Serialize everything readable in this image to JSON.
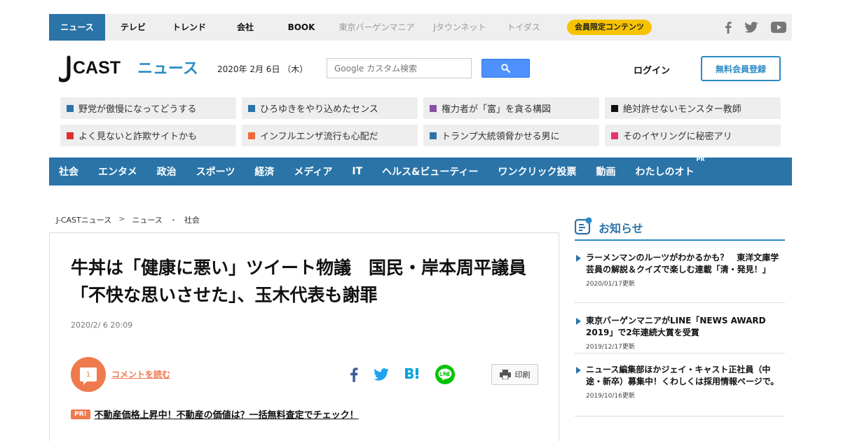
{
  "topnav": {
    "items": [
      {
        "label": "ニュース",
        "active": true
      },
      {
        "label": "テレビ"
      },
      {
        "label": "トレンド"
      },
      {
        "label": "会社"
      },
      {
        "label": "BOOK"
      },
      {
        "label": "東京バーゲンマニア",
        "muted": true
      },
      {
        "label": "Jタウンネット",
        "muted": true
      },
      {
        "label": "トイダス",
        "muted": true
      }
    ],
    "member_pill": "会員限定コンテンツ"
  },
  "header": {
    "logo_prefix": "J",
    "logo_cast": "CAST",
    "logo_news": "ニュース",
    "date": "2020年 2月 6日 （木）",
    "search_placeholder": "Google カスタム検索",
    "login": "ログイン",
    "register": "無料会員登録"
  },
  "topics": [
    {
      "text": "野党が傲慢になってどうする",
      "color": "#2a74a8"
    },
    {
      "text": "ひろゆきをやり込めたセンス",
      "color": "#2a74a8"
    },
    {
      "text": "権力者が「富」を貪る構図",
      "color": "#8a4fa8"
    },
    {
      "text": "絶対許せないモンスター教師",
      "color": "#111111"
    },
    {
      "text": "よく見ないと詐欺サイトかも",
      "color": "#e0302a"
    },
    {
      "text": "インフルエンザ流行も心配だ",
      "color": "#ef6a3a"
    },
    {
      "text": "トランプ大統領脅かせる男に",
      "color": "#2a74a8"
    },
    {
      "text": "そのイヤリングに秘密アリ",
      "color": "#e8336b"
    }
  ],
  "catnav": {
    "items": [
      "社会",
      "エンタメ",
      "政治",
      "スポーツ",
      "経済",
      "メディア",
      "IT",
      "ヘルス&ビューティー",
      "ワンクリック投票",
      "動画",
      "わたしのオト"
    ],
    "pr_badge": "PR"
  },
  "breadcrumb": [
    "J-CASTニュース",
    ">",
    "ニュース",
    "・",
    "社会"
  ],
  "article": {
    "title": "牛丼は「健康に悪い」ツイート物議　国民・岸本周平議員「不快な思いさせた」、玉木代表も謝罪",
    "date": "2020/2/ 6 20:09",
    "comment_count": "1",
    "comment_link": "コメントを読む",
    "print_label": "印刷",
    "pr_badge": "PR!",
    "pr_text": "不動産価格上昇中！不動産の価値は？一括無料査定でチェック！"
  },
  "sidebar": {
    "title": "お知らせ",
    "items": [
      {
        "text": "ラーメンマンのルーツがわかるかも？　東洋文庫学芸員の解説＆クイズで楽しむ連載「清・発見！」",
        "updated": "2020/01/17更新"
      },
      {
        "text": "東京バーゲンマニアがLINE「NEWS AWARD 2019」で2年連続大賞を受賞",
        "updated": "2019/12/17更新"
      },
      {
        "text": "ニュース編集部ほかジェイ・キャスト正社員（中途・新卒）募集中！くわしくは採用情報ページで。",
        "updated": "2019/10/16更新"
      }
    ]
  },
  "colors": {
    "brand_blue": "#2a74a8",
    "accent_orange": "#ef7a4e",
    "pill_yellow": "#f7c300"
  }
}
